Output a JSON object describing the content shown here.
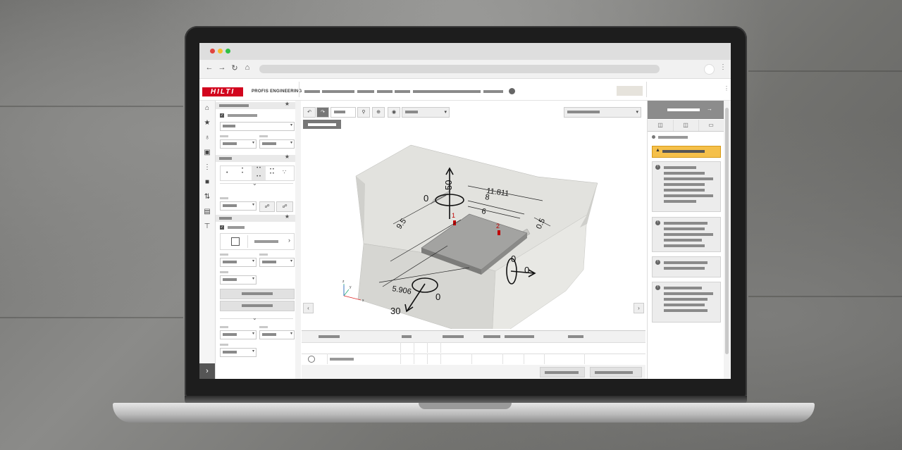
{
  "app": {
    "brand": "HILTI",
    "product_name": "PROFIS ENGINEERING"
  },
  "browser": {
    "traffic_lights": [
      "#e0443e",
      "#f5bd2e",
      "#2fc045"
    ],
    "nav_icons": [
      "back-icon",
      "forward-icon",
      "refresh-icon",
      "home-icon"
    ]
  },
  "model": {
    "load_labels": [
      "50",
      "0",
      "0",
      "0",
      "30",
      "0"
    ],
    "dimensions": [
      "11.811",
      "8",
      "6",
      "9.5",
      "0.5",
      "5.906"
    ],
    "anchor_labels": [
      "1",
      "2"
    ],
    "axis_labels": [
      "z",
      "y",
      "x"
    ]
  },
  "colors": {
    "brand_red": "#d2051e",
    "anchor_red": "#c00000",
    "warning": "#f5c04a",
    "concrete": "#d6d6d2",
    "plate": "#9a9a98"
  }
}
